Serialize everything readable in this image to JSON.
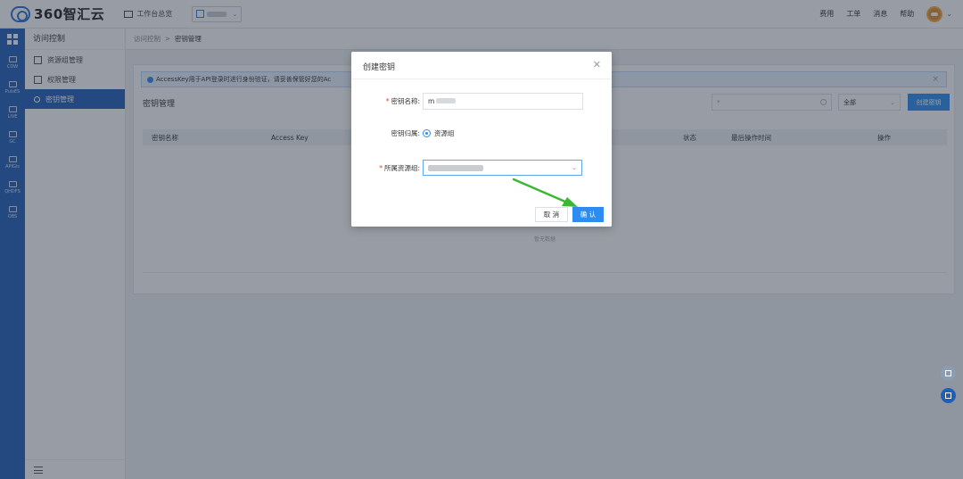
{
  "topbar": {
    "brand": "360智汇云",
    "workbench": "工作台总览",
    "ws_icon_text": "全",
    "links": [
      "费用",
      "工单",
      "消息",
      "帮助"
    ]
  },
  "rail": {
    "items": [
      "CDW",
      "PulsES",
      "LIVE",
      "GC",
      "APIGis",
      "QHDFS",
      "OBS"
    ]
  },
  "sidemenu": {
    "title": "访问控制",
    "items": [
      "资源组管理",
      "权限管理",
      "密钥管理"
    ],
    "active_index": 2
  },
  "breadcrumb": {
    "parent": "访问控制",
    "separator": ">",
    "current": "密钥管理"
  },
  "card": {
    "notice": "AccessKey用于API登录时进行身份验证，请妥善保管好您的Ac",
    "title": "密钥管理",
    "search_placeholder": "*",
    "status_value": "全部",
    "create_button": "创建密钥",
    "columns": [
      "密钥名称",
      "Access Key",
      "状态",
      "最后操作时间",
      "操作"
    ],
    "empty_text": "暂无数据"
  },
  "dialog": {
    "title": "创建密钥",
    "name_label": "密钥名称:",
    "name_value": "m",
    "owner_label": "密钥归属:",
    "owner_option": "资源组",
    "group_label": "所属资源组:",
    "cancel": "取 消",
    "confirm": "确 认"
  },
  "colors": {
    "brand": "#1f5fb8",
    "primary": "#2d8cf0",
    "arrow": "#3bb832"
  }
}
